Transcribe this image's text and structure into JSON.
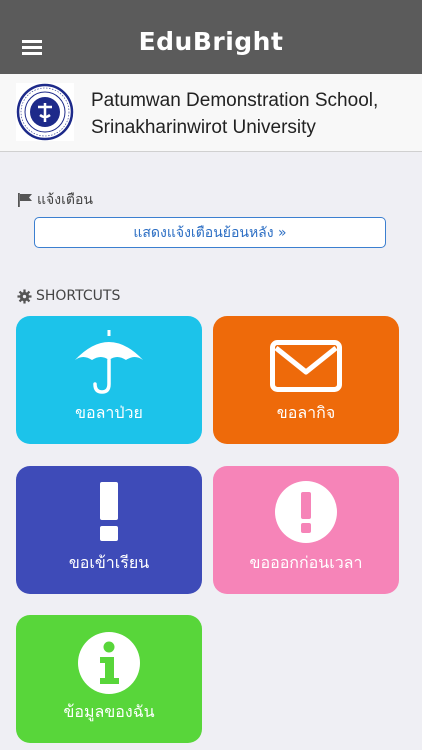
{
  "app": {
    "title": "EduBright"
  },
  "school": {
    "name_line1": "Patumwan Demonstration School,",
    "name_line2": "Srinakharinwirot University"
  },
  "notifications": {
    "label": "แจ้งเตือน",
    "history_button": "แสดงแจ้งเตือนย้อนหลัง »"
  },
  "shortcuts": {
    "label": "SHORTCUTS",
    "items": [
      {
        "label": "ขอลาป่วย",
        "icon": "umbrella-icon",
        "color": "#1cc3ea"
      },
      {
        "label": "ขอลากิจ",
        "icon": "envelope-icon",
        "color": "#ee6a0a"
      },
      {
        "label": "ขอเข้าเรียน",
        "icon": "exclamation-icon",
        "color": "#3e4bb8"
      },
      {
        "label": "ขอออกก่อนเวลา",
        "icon": "exclamation-circle-icon",
        "color": "#f684b8"
      },
      {
        "label": "ข้อมูลของฉัน",
        "icon": "info-circle-icon",
        "color": "#58d63a"
      }
    ]
  }
}
